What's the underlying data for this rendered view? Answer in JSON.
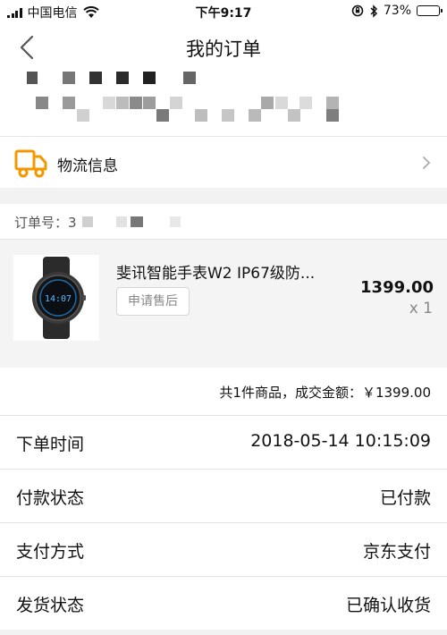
{
  "status_bar": {
    "carrier": "中国电信",
    "time": "下午9:17",
    "battery": "73%",
    "battery_level": 0.73
  },
  "nav": {
    "title": "我的订单",
    "back_icon": "chevron-left-icon"
  },
  "logistics": {
    "label": "物流信息",
    "icon": "truck-icon",
    "accent_color": "#f39800"
  },
  "order": {
    "number_label": "订单号：",
    "number_visible_prefix": "3"
  },
  "product": {
    "title": "斐讯智能手表W2 IP67级防...",
    "after_sale_label": "申请售后",
    "price": "1399.00",
    "quantity": "x 1",
    "watch_screen_text": "14:07"
  },
  "summary": {
    "text": "共1件商品，成交金额：￥1399.00"
  },
  "details": [
    {
      "key": "下单时间",
      "value": "2018-05-14 10:15:09"
    },
    {
      "key": "付款状态",
      "value": "已付款"
    },
    {
      "key": "支付方式",
      "value": "京东支付"
    },
    {
      "key": "发货状态",
      "value": "已确认收货"
    }
  ]
}
